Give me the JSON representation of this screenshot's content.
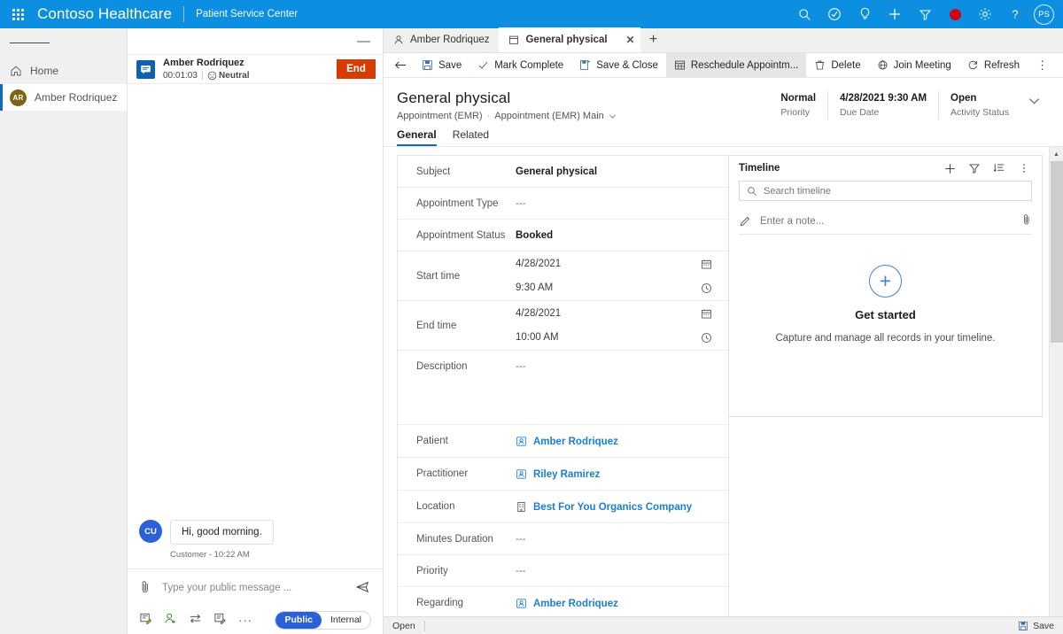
{
  "topbar": {
    "waffle_label": "app-launcher",
    "brand": "Contoso Healthcare",
    "app_name": "Patient Service Center",
    "icons": [
      "search-icon",
      "assistant-icon",
      "insights-icon",
      "plus-icon",
      "filter-icon",
      "record-icon",
      "settings-icon",
      "help-icon"
    ],
    "avatar_initials": "PS",
    "bg_color": "#0c8fe0"
  },
  "sidebar": {
    "hamburger_label": "site-map",
    "items": [
      {
        "label": "Home",
        "icon": "home-icon",
        "selected": false
      },
      {
        "label": "Amber Rodriquez",
        "icon": "avatar",
        "initials": "AR",
        "selected": true
      }
    ]
  },
  "conversation": {
    "minimize_label": "—",
    "customer_name": "Amber Rodriquez",
    "timer": "00:01:03",
    "sentiment": "Neutral",
    "end_button": "End",
    "end_button_color": "#d83b01",
    "messages": [
      {
        "initials": "CU",
        "text": "Hi, good morning.",
        "meta": "Customer - 10:22 AM"
      }
    ],
    "composer": {
      "placeholder": "Type your public message ...",
      "value": "",
      "attach_icon": "attachment-icon",
      "send_icon": "send-icon",
      "tools": [
        "quick-reply-icon",
        "knowledge-article-icon",
        "transfer-icon",
        "note-icon",
        "more-icon"
      ],
      "mode_public": "Public",
      "mode_internal": "Internal",
      "mode_selected": "Public"
    }
  },
  "tabs": [
    {
      "label": "Amber Rodriquez",
      "icon": "contact-icon",
      "active": false,
      "closable": false
    },
    {
      "label": "General physical",
      "icon": "appointment-icon",
      "active": true,
      "closable": true
    }
  ],
  "tab_add_label": "+",
  "commandbar": {
    "back_icon": "back-arrow-icon",
    "commands": [
      {
        "label": "Save",
        "icon": "save-icon",
        "highlight": false
      },
      {
        "label": "Mark Complete",
        "icon": "check-icon",
        "highlight": false
      },
      {
        "label": "Save & Close",
        "icon": "save-close-icon",
        "highlight": false
      },
      {
        "label": "Reschedule Appointm...",
        "icon": "calendar-grid-icon",
        "highlight": true
      },
      {
        "label": "Delete",
        "icon": "trash-icon",
        "highlight": false
      },
      {
        "label": "Join Meeting",
        "icon": "meeting-icon",
        "highlight": false
      },
      {
        "label": "Refresh",
        "icon": "refresh-icon",
        "highlight": false
      }
    ],
    "more_label": "⋮"
  },
  "record": {
    "title": "General physical",
    "entity": "Appointment (EMR)",
    "form": "Appointment (EMR) Main",
    "props": [
      {
        "value": "Normal",
        "label": "Priority"
      },
      {
        "value": "4/28/2021 9:30 AM",
        "label": "Due Date"
      },
      {
        "value": "Open",
        "label": "Activity Status"
      }
    ],
    "chevron_icon": "chevron-down-icon"
  },
  "form_tabs": [
    {
      "label": "General",
      "active": true
    },
    {
      "label": "Related",
      "active": false
    }
  ],
  "form_fields": [
    {
      "label": "Subject",
      "value": "General physical",
      "type": "text",
      "empty": false
    },
    {
      "label": "Appointment Type",
      "value": "---",
      "type": "text",
      "empty": true
    },
    {
      "label": "Appointment Status",
      "value": "Booked",
      "type": "text",
      "empty": false
    },
    {
      "label": "Start time",
      "date": "4/28/2021",
      "time": "9:30 AM",
      "type": "datetime"
    },
    {
      "label": "End time",
      "date": "4/28/2021",
      "time": "10:00 AM",
      "type": "datetime"
    },
    {
      "label": "Description",
      "value": "---",
      "type": "textarea",
      "empty": true
    },
    {
      "label": "Patient",
      "value": "Amber Rodriquez",
      "type": "lookup",
      "icon": "contact-lookup-icon"
    },
    {
      "label": "Practitioner",
      "value": "Riley Ramirez",
      "type": "lookup",
      "icon": "contact-lookup-icon"
    },
    {
      "label": "Location",
      "value": "Best For You Organics Company",
      "type": "lookup",
      "icon": "account-lookup-icon"
    },
    {
      "label": "Minutes Duration",
      "value": "---",
      "type": "text",
      "empty": true
    },
    {
      "label": "Priority",
      "value": "---",
      "type": "text",
      "empty": true
    },
    {
      "label": "Regarding",
      "value": "Amber Rodriquez",
      "type": "lookup",
      "icon": "contact-lookup-icon"
    }
  ],
  "timeline": {
    "title": "Timeline",
    "actions": [
      "plus-icon",
      "filter-icon",
      "sort-icon",
      "more-vertical-icon"
    ],
    "search_placeholder": "Search timeline",
    "search_value": "",
    "note_placeholder": "Enter a note...",
    "note_value": "",
    "attach_icon": "attachment-icon",
    "empty_title": "Get started",
    "empty_caption": "Capture and manage all records in your timeline.",
    "empty_plus": "+"
  },
  "statusbar": {
    "status": "Open",
    "save_label": "Save",
    "save_icon": "save-icon"
  },
  "colors": {
    "accent": "#0f6cbd",
    "brand_blue": "#0c8fe0",
    "link": "#1a7fd4",
    "danger": "#d83b01",
    "record_red": "#d0021b"
  }
}
